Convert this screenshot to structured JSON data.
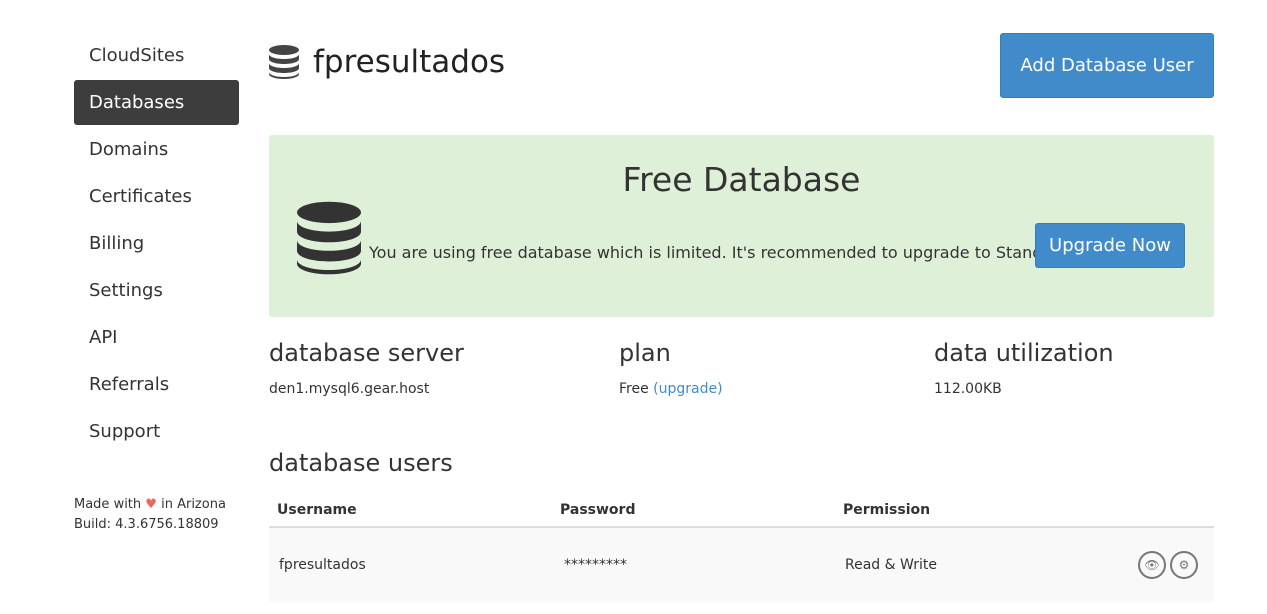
{
  "sidebar": {
    "items": [
      "CloudSites",
      "Databases",
      "Domains",
      "Certificates",
      "Billing",
      "Settings",
      "API",
      "Referrals",
      "Support"
    ],
    "active": "Databases"
  },
  "footer": {
    "made_prefix": "Made with",
    "made_suffix": "in Arizona",
    "build": "Build: 4.3.6756.18809"
  },
  "header": {
    "title": "fpresultados",
    "add_user_label": "Add Database User"
  },
  "banner": {
    "title": "Free Database",
    "message": "You are using free database which is limited. It's recommended to upgrade to Standard.",
    "upgrade_label": "Upgrade Now"
  },
  "info": {
    "server_label": "database server",
    "server": "den1.mysql6.gear.host",
    "plan_label": "plan",
    "plan": "Free",
    "plan_link": "(upgrade)",
    "util_label": "data utilization",
    "util": "112.00KB"
  },
  "users": {
    "heading": "database users",
    "columns": [
      "Username",
      "Password",
      "Permission"
    ],
    "rows": [
      {
        "username": "fpresultados",
        "password": "*********",
        "permission": "Read & Write"
      }
    ]
  },
  "colors": {
    "accent": "#428bca",
    "banner": "#dff0d8",
    "active_nav": "#3d3d3d"
  }
}
